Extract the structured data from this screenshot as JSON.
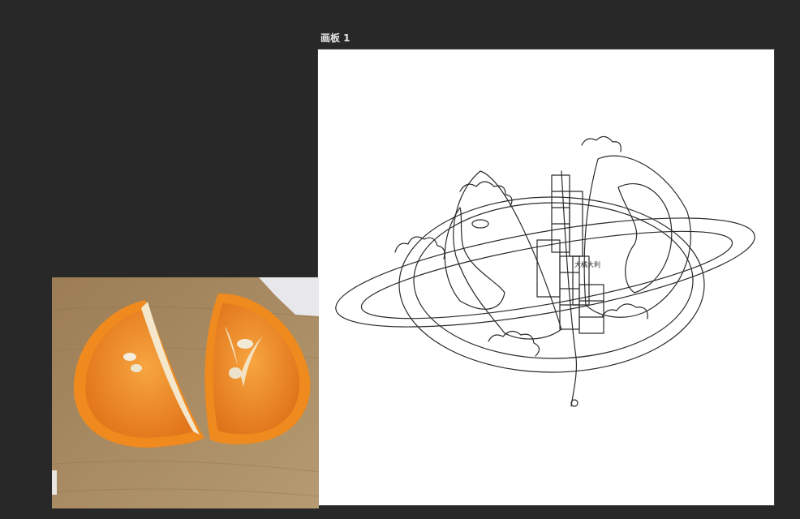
{
  "artboard": {
    "label": "画板 1",
    "illustration_text": "大橘大利"
  },
  "colors": {
    "canvas_background": "#282828",
    "artboard_background": "#ffffff",
    "line_art": "#2a2a2a",
    "orange_flesh": "#f08a1e",
    "table_wood": "#a78a62"
  }
}
